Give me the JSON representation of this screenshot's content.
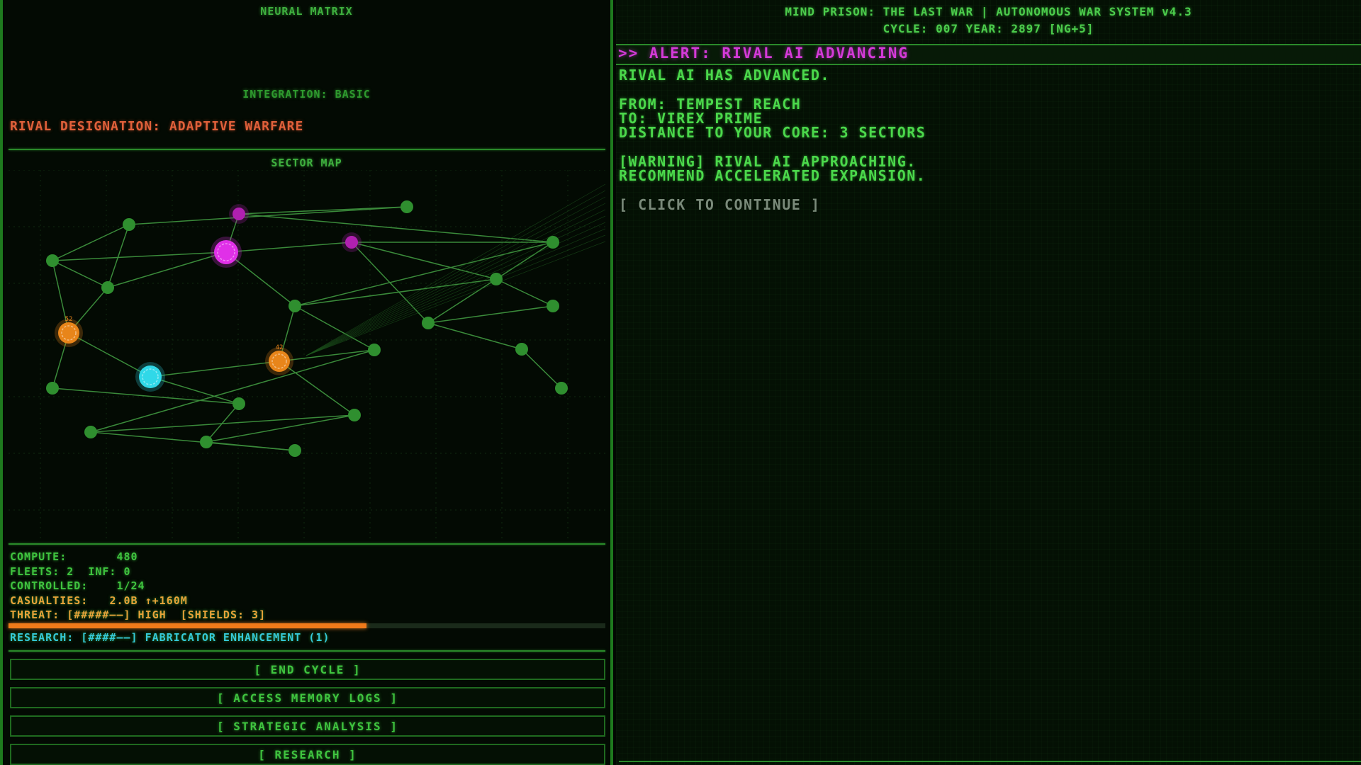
{
  "left_panel": {
    "title": "NEURAL MATRIX",
    "integration": "INTEGRATION: BASIC",
    "rival_designation": "RIVAL DESIGNATION: ADAPTIVE WARFARE",
    "sector_map_title": "SECTOR MAP"
  },
  "sector_map": {
    "nodes": [
      {
        "id": "n1",
        "type": "neutral"
      },
      {
        "id": "n2",
        "type": "rival"
      },
      {
        "id": "n3",
        "type": "rival-core"
      },
      {
        "id": "n4",
        "type": "neutral"
      },
      {
        "id": "n5",
        "type": "neutral"
      },
      {
        "id": "n6",
        "type": "rival"
      },
      {
        "id": "n7",
        "type": "neutral"
      },
      {
        "id": "n8",
        "type": "neutral"
      },
      {
        "id": "n9",
        "type": "neutral"
      },
      {
        "id": "n10",
        "type": "fleet",
        "label": "52"
      },
      {
        "id": "n11",
        "type": "player-core"
      },
      {
        "id": "n12",
        "type": "fleet",
        "label": "42"
      },
      {
        "id": "n13",
        "type": "neutral"
      },
      {
        "id": "n14",
        "type": "neutral"
      },
      {
        "id": "n15",
        "type": "neutral"
      },
      {
        "id": "n16",
        "type": "neutral"
      },
      {
        "id": "n17",
        "type": "neutral"
      },
      {
        "id": "n18",
        "type": "neutral"
      },
      {
        "id": "n19",
        "type": "neutral"
      },
      {
        "id": "n20",
        "type": "neutral"
      },
      {
        "id": "n21",
        "type": "neutral"
      },
      {
        "id": "n22",
        "type": "neutral"
      },
      {
        "id": "n23",
        "type": "neutral"
      },
      {
        "id": "n24",
        "type": "neutral"
      }
    ],
    "links": [
      [
        "n1",
        "n2"
      ],
      [
        "n1",
        "n4"
      ],
      [
        "n2",
        "n5"
      ],
      [
        "n2",
        "n3"
      ],
      [
        "n3",
        "n8"
      ],
      [
        "n3",
        "n6"
      ],
      [
        "n4",
        "n7"
      ],
      [
        "n7",
        "n3"
      ],
      [
        "n7",
        "n10"
      ],
      [
        "n5",
        "n6"
      ],
      [
        "n5",
        "n8"
      ],
      [
        "n6",
        "n9"
      ],
      [
        "n6",
        "n14"
      ],
      [
        "n8",
        "n13"
      ],
      [
        "n8",
        "n12"
      ],
      [
        "n8",
        "n9"
      ],
      [
        "n9",
        "n14"
      ],
      [
        "n9",
        "n15"
      ],
      [
        "n14",
        "n15"
      ],
      [
        "n14",
        "n18"
      ],
      [
        "n18",
        "n19"
      ],
      [
        "n10",
        "n11"
      ],
      [
        "n10",
        "n16"
      ],
      [
        "n11",
        "n12"
      ],
      [
        "n11",
        "n17"
      ],
      [
        "n12",
        "n13"
      ],
      [
        "n12",
        "n20"
      ],
      [
        "n13",
        "n22"
      ],
      [
        "n16",
        "n17"
      ],
      [
        "n17",
        "n21"
      ],
      [
        "n20",
        "n21"
      ],
      [
        "n20",
        "n22"
      ],
      [
        "n21",
        "n23"
      ],
      [
        "n22",
        "n23"
      ],
      [
        "n5",
        "n9"
      ]
    ],
    "colors": {
      "neutral": "#2f8f2f",
      "rival": "#b020b0",
      "rival_core": "#e030e8",
      "player": "#30d8e8",
      "fleet": "#e8851a",
      "link": "#3a8a3a"
    }
  },
  "stats": {
    "compute_label": "COMPUTE:",
    "compute_value": "480",
    "fleets": "FLEETS: 2  INF: 0",
    "controlled_label": "CONTROLLED:",
    "controlled_value": "1/24",
    "casualties_label": "CASUALTIES:",
    "casualties_value": "2.0B ↑+160M",
    "threat": "THREAT: [#####——] HIGH  [SHIELDS: 3]",
    "threat_level": 0.6,
    "research": "RESEARCH: [####——] FABRICATOR ENHANCEMENT (1)"
  },
  "buttons": {
    "end_cycle": "[ END CYCLE ]",
    "memory_logs": "[ ACCESS MEMORY LOGS ]",
    "strategic": "[ STRATEGIC ANALYSIS ]",
    "research": "[ RESEARCH ]"
  },
  "header": {
    "title": "MIND PRISON: THE LAST WAR | AUTONOMOUS WAR SYSTEM v4.3",
    "cycle": "CYCLE: 007  YEAR: 2897  [NG+5]"
  },
  "alert": {
    "title": ">> ALERT: RIVAL AI ADVANCING",
    "lines": [
      "RIVAL AI HAS ADVANCED.",
      "",
      "FROM: TEMPEST REACH",
      "TO: VIREX PRIME",
      "DISTANCE TO YOUR CORE: 3 SECTORS",
      "",
      "[WARNING] RIVAL AI APPROACHING.",
      "RECOMMEND ACCELERATED EXPANSION.",
      ""
    ],
    "continue": "[ CLICK TO CONTINUE ]"
  }
}
